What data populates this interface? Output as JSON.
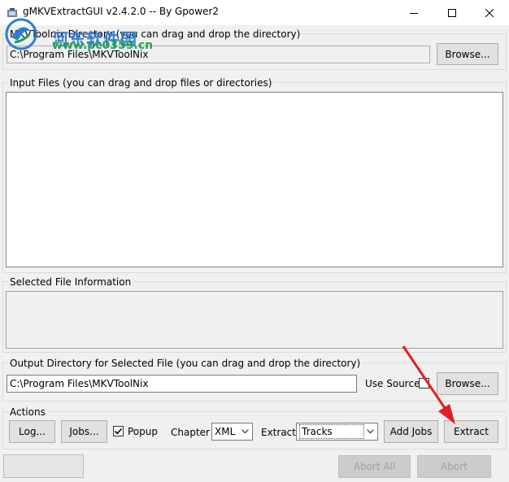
{
  "window": {
    "title": "gMKVExtractGUI v2.4.2.0 -- By Gpower2"
  },
  "mkvtoolnix": {
    "label": "MKVToolnix Directory (you can drag and drop the directory)",
    "path": "C:\\Program Files\\MKVToolNix",
    "browse": "Browse..."
  },
  "input": {
    "label": "Input Files (you can drag and drop files or directories)"
  },
  "selected_info": {
    "label": "Selected File Information"
  },
  "output": {
    "label": "Output Directory for Selected File (you can drag and drop the directory)",
    "path": "C:\\Program Files\\MKVToolNix",
    "use_source": "Use Source",
    "browse": "Browse..."
  },
  "actions": {
    "label": "Actions",
    "log": "Log...",
    "jobs": "Jobs...",
    "popup": "Popup",
    "chapter_label": "Chapter",
    "chapter_value": "XML",
    "extract_label": "Extract",
    "extract_value": "Tracks",
    "add_jobs": "Add Jobs",
    "extract_button": "Extract"
  },
  "footer": {
    "abort_all": "Abort All",
    "abort": "Abort"
  },
  "watermark": {
    "cn": "河东软件园",
    "url": "www.pc0359.cn"
  },
  "colors": {
    "arrow": "#e02020",
    "watermark_blue": "#2b7fd6",
    "watermark_green": "#1aa04a"
  }
}
